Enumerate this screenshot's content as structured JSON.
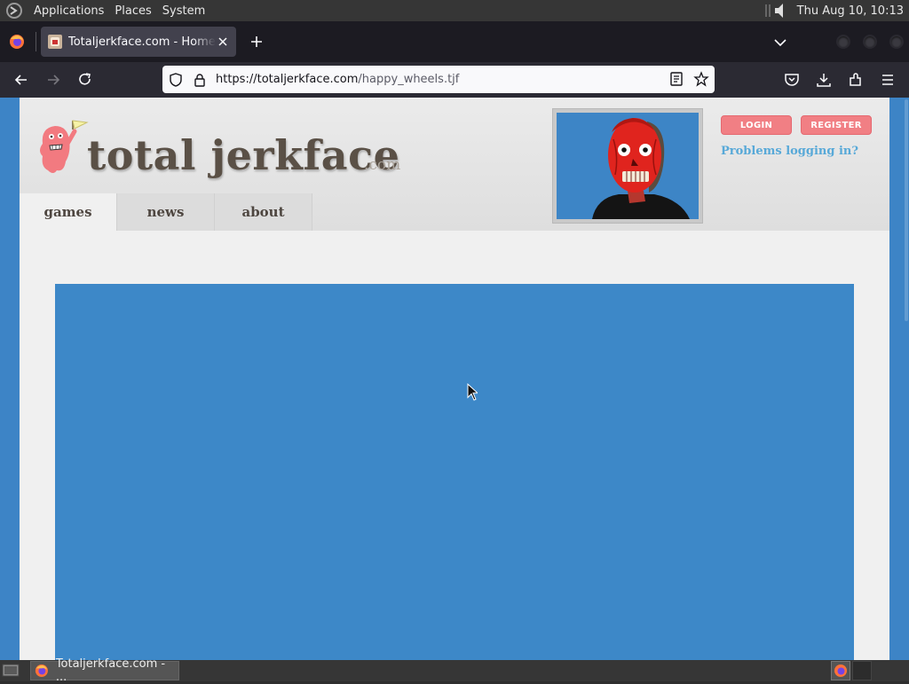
{
  "top_panel": {
    "menus": [
      "Applications",
      "Places",
      "System"
    ],
    "clock": "Thu Aug 10, 10:13"
  },
  "browser": {
    "tab_title": "Totaljerkface.com - Home Of",
    "url_host": "https://totaljerkface.com",
    "url_path": "/happy_wheels.tjf"
  },
  "site": {
    "logo_text": "total jerkface",
    "logo_tld": ".com",
    "nav": [
      "games",
      "news",
      "about"
    ],
    "active_nav": "games",
    "login_label": "LOGIN",
    "register_label": "REGISTER",
    "problems_link": "Problems logging in?"
  },
  "taskbar": {
    "window_label": "Totaljerkface.com - ..."
  },
  "colors": {
    "page_bg": "#3d84c6",
    "button": "#f17f84",
    "link": "#58a9d8"
  }
}
